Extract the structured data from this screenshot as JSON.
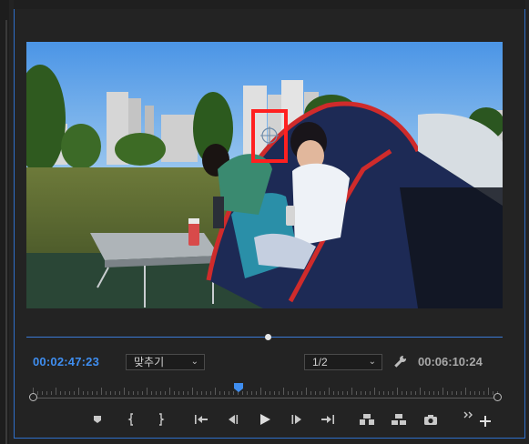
{
  "program_monitor": {
    "current_timecode": "00:02:47:23",
    "duration_timecode": "00:06:10:24",
    "fit_dropdown": {
      "value": "맞추기"
    },
    "resolution_dropdown": {
      "value": "1/2"
    }
  },
  "controls": [
    "marker-icon",
    "mark-in-icon",
    "mark-out-icon",
    "go-to-in-icon",
    "step-back-icon",
    "play-icon",
    "step-forward-icon",
    "go-to-out-icon",
    "lift-icon",
    "extract-icon",
    "export-frame-icon",
    "more-icon",
    "add-button-icon"
  ],
  "colors": {
    "accent": "#3f8ef0",
    "panel_border": "#2f6fc9",
    "highlight_box": "#ff2020"
  }
}
